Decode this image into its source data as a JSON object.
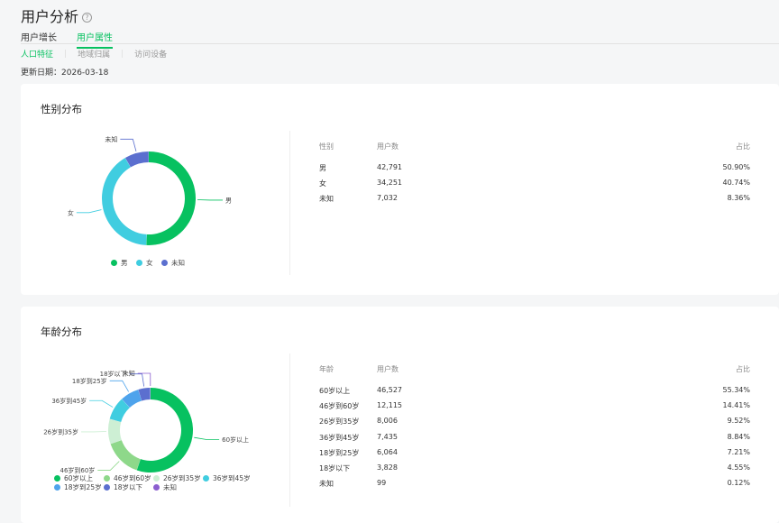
{
  "page": {
    "title": "用户分析",
    "help_icon": "?"
  },
  "tabs": [
    {
      "label": "用户增长"
    },
    {
      "label": "用户属性"
    }
  ],
  "subtabs": [
    {
      "label": "人口特征"
    },
    {
      "label": "地域归属"
    },
    {
      "label": "访问设备"
    }
  ],
  "update": {
    "label": "更新日期：",
    "value": "2026-03-18"
  },
  "gender": {
    "title": "性别分布",
    "headers": [
      "性别",
      "用户数",
      "占比"
    ],
    "rows": [
      {
        "name": "男",
        "count": "42,791",
        "pct": "50.90%",
        "value": 42791,
        "color": "#07c160"
      },
      {
        "name": "女",
        "count": "34,251",
        "pct": "40.74%",
        "value": 34251,
        "color": "#40cde0"
      },
      {
        "name": "未知",
        "count": "7,032",
        "pct": "8.36%",
        "value": 7032,
        "color": "#5b6fcf"
      }
    ]
  },
  "age": {
    "title": "年龄分布",
    "headers": [
      "年龄",
      "用户数",
      "占比"
    ],
    "rows": [
      {
        "name": "60岁以上",
        "count": "46,527",
        "pct": "55.34%",
        "value": 46527,
        "color": "#07c160"
      },
      {
        "name": "46岁到60岁",
        "count": "12,115",
        "pct": "14.41%",
        "value": 12115,
        "color": "#8ed88a"
      },
      {
        "name": "26岁到35岁",
        "count": "8,006",
        "pct": "9.52%",
        "value": 8006,
        "color": "#cdefd4"
      },
      {
        "name": "36岁到45岁",
        "count": "7,435",
        "pct": "8.84%",
        "value": 7435,
        "color": "#40cde0"
      },
      {
        "name": "18岁到25岁",
        "count": "6,064",
        "pct": "7.21%",
        "value": 6064,
        "color": "#4ea3ec"
      },
      {
        "name": "18岁以下",
        "count": "3,828",
        "pct": "4.55%",
        "value": 3828,
        "color": "#5b6fcf"
      },
      {
        "name": "未知",
        "count": "99",
        "pct": "0.12%",
        "value": 99,
        "color": "#8b5fcf"
      }
    ]
  }
}
